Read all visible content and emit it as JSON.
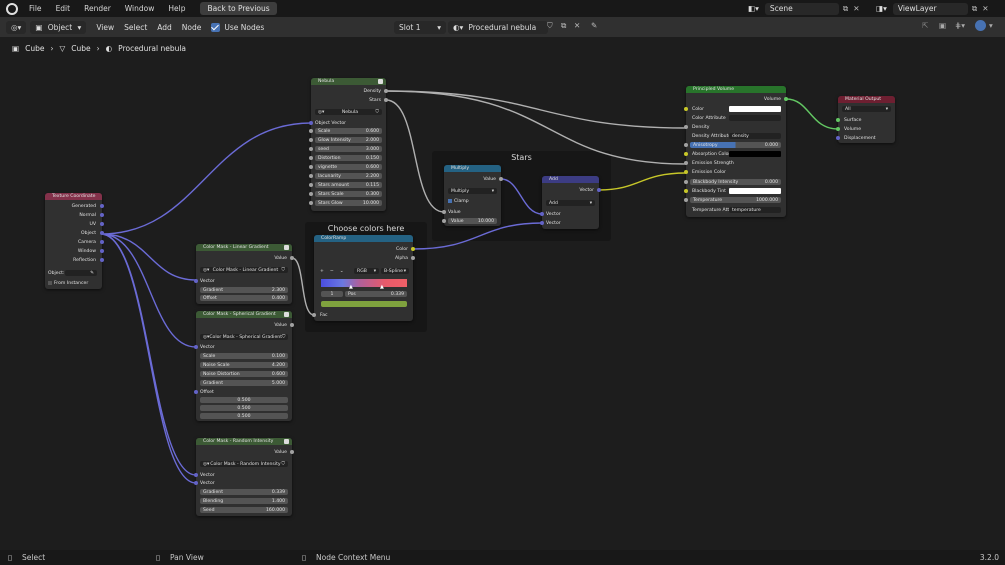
{
  "topbar": {
    "menus": [
      "File",
      "Edit",
      "Render",
      "Window",
      "Help"
    ],
    "back_button": "Back to Previous",
    "scene": "Scene",
    "view_layer": "ViewLayer"
  },
  "header": {
    "object_mode": "Object",
    "menus": [
      "View",
      "Select",
      "Add",
      "Node"
    ],
    "use_nodes": "Use Nodes",
    "slot": "Slot 1",
    "material": "Procedural nebula"
  },
  "breadcrumb": [
    "Cube",
    "Cube",
    "Procedural nebula"
  ],
  "frames": {
    "stars": "Stars",
    "choose": "Choose colors here"
  },
  "nodes": {
    "texcoord": {
      "title": "Texture Coordinate",
      "outputs": [
        "Generated",
        "Normal",
        "UV",
        "Object",
        "Camera",
        "Window",
        "Reflection"
      ],
      "object_label": "Object:",
      "from_instancer": "From Instancer"
    },
    "nebula": {
      "title": "Nebula",
      "outputs": [
        "Density",
        "Stars"
      ],
      "group": "Nebula",
      "input_vector": "Object Vector",
      "params": [
        {
          "name": "Scale",
          "value": "0.600"
        },
        {
          "name": "Glow Intensity",
          "value": "2.000"
        },
        {
          "name": "seed",
          "value": "3.000"
        },
        {
          "name": "Distortion",
          "value": "0.150"
        },
        {
          "name": "vignette",
          "value": "0.600"
        },
        {
          "name": "lacunarity",
          "value": "2.200"
        },
        {
          "name": "Stars amount",
          "value": "0.115"
        },
        {
          "name": "Stars Scale",
          "value": "0.300"
        },
        {
          "name": "Stars Glow",
          "value": "10.000"
        }
      ]
    },
    "multiply": {
      "title": "Multiply",
      "output": "Value",
      "op": "Multiply",
      "clamp": "Clamp",
      "input": "Value",
      "param": {
        "name": "Value",
        "value": "10.000"
      }
    },
    "add": {
      "title": "Add",
      "output": "Vector",
      "op": "Add",
      "inputs": [
        "Vector",
        "Vector"
      ]
    },
    "colorramp": {
      "title": "ColorRamp",
      "outputs": [
        "Color",
        "Alpha"
      ],
      "mode": "RGB",
      "interp": "B-Spline",
      "index": "1",
      "pos_label": "Pos",
      "pos": "0.339",
      "input": "Fac"
    },
    "linear": {
      "title": "Color Mask - Linear Gradient",
      "output": "Value",
      "group": "Color Mask - Linear Gradient",
      "input": "Vector",
      "params": [
        {
          "name": "Gradient",
          "value": "2.300"
        },
        {
          "name": "Offset",
          "value": "0.400"
        }
      ]
    },
    "spherical": {
      "title": "Color Mask - Spherical Gradient",
      "output": "Value",
      "group": "Color Mask - Spherical Gradient",
      "input": "Vector",
      "params": [
        {
          "name": "Scale",
          "value": "0.100"
        },
        {
          "name": "Noise Scale",
          "value": "4.200"
        },
        {
          "name": "Noise Distortion",
          "value": "0.600"
        },
        {
          "name": "Gradient",
          "value": "5.000"
        }
      ],
      "offset_label": "Offset",
      "offset": [
        "0.500",
        "0.500",
        "0.500"
      ]
    },
    "random": {
      "title": "Color Mask - Random Intensity",
      "output": "Value",
      "group": "Color Mask - Random Intensity",
      "inputs": [
        "Vector",
        "Vector"
      ],
      "params": [
        {
          "name": "Gradient",
          "value": "0.339"
        },
        {
          "name": "Blending",
          "value": "1.400"
        },
        {
          "name": "Seed",
          "value": "160.000"
        }
      ]
    },
    "principled": {
      "title": "Principled Volume",
      "output": "Volume",
      "rows": [
        "Color",
        "Color Attribute",
        "Density",
        "Density Attribute",
        "Anisotropy",
        "Absorption Color",
        "Emission Strength",
        "Emission Color",
        "Blackbody Intensity",
        "Blackbody Tint",
        "Temperature",
        "Temperature Attribute"
      ],
      "density_attr": "density",
      "anisotropy": "0.000",
      "blackbody": "0.000",
      "temperature": "1000.000",
      "temp_attr": "temperature"
    },
    "output": {
      "title": "Material Output",
      "target": "All",
      "inputs": [
        "Surface",
        "Volume",
        "Displacement"
      ]
    }
  },
  "status": {
    "select": "Select",
    "pan": "Pan View",
    "context": "Node Context Menu",
    "version": "3.2.0"
  },
  "colors": {
    "vector_socket": "#6363c7",
    "value_socket": "#a1a1a1",
    "color_socket": "#c7c729",
    "shader_socket": "#63c763",
    "input_header": "#83314a",
    "group_header": "#3c5a35",
    "converter_header": "#246283",
    "vector_header": "#3c3c83",
    "shader_header": "#28742b",
    "output_header": "#6e1f31"
  }
}
